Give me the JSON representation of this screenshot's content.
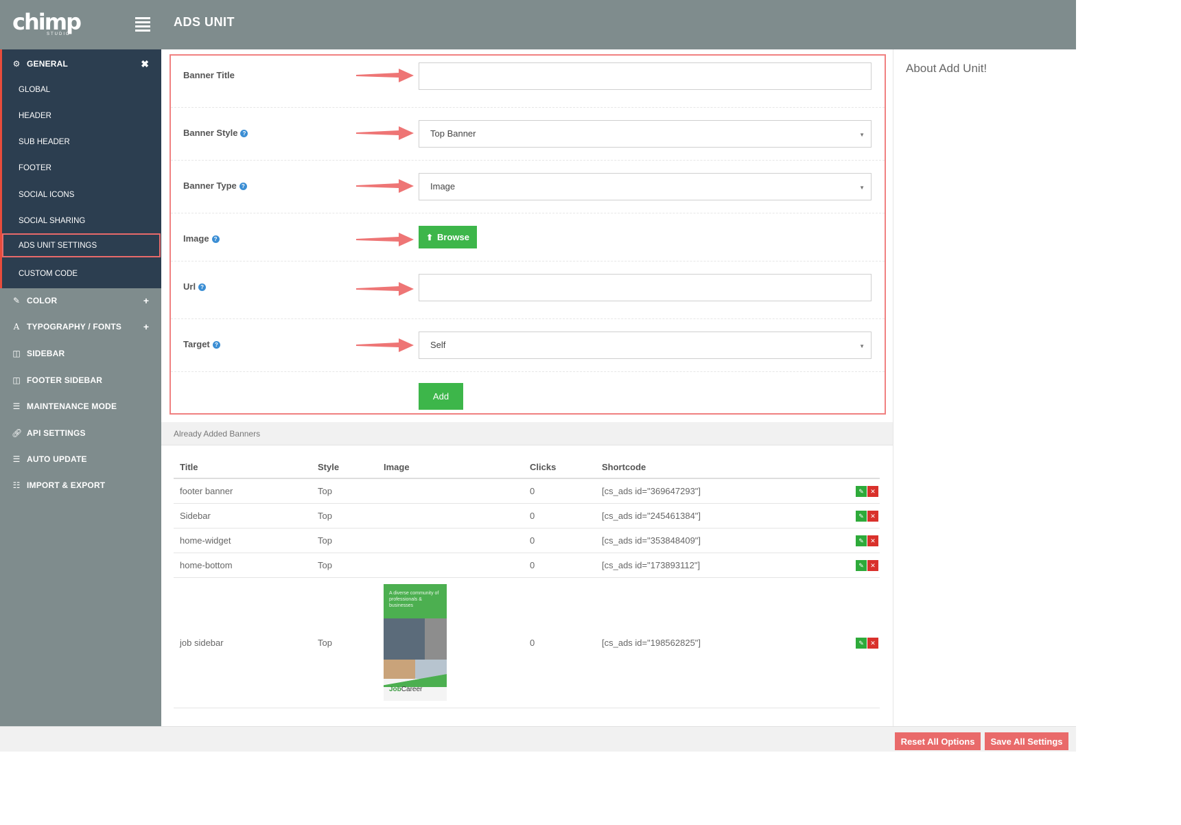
{
  "header": {
    "logo_text": "chimp",
    "logo_sub": "STUDIO",
    "title": "ADS UNIT"
  },
  "sidebar": {
    "general": {
      "label": "GENERAL",
      "toggle": "✖",
      "icon": "gear-icon"
    },
    "general_items": [
      {
        "label": "GLOBAL"
      },
      {
        "label": "HEADER"
      },
      {
        "label": "SUB HEADER"
      },
      {
        "label": "FOOTER"
      },
      {
        "label": "SOCIAL ICONS"
      },
      {
        "label": "SOCIAL SHARING"
      },
      {
        "label": "ADS UNIT SETTINGS",
        "active": true
      },
      {
        "label": "CUSTOM CODE"
      }
    ],
    "items": [
      {
        "label": "COLOR",
        "icon": "magic-wand-icon",
        "toggle": "+"
      },
      {
        "label": "TYPOGRAPHY / FONTS",
        "icon": "font-icon",
        "toggle": "+"
      },
      {
        "label": "SIDEBAR",
        "icon": "columns-icon"
      },
      {
        "label": "FOOTER SIDEBAR",
        "icon": "columns-icon"
      },
      {
        "label": "MAINTENANCE MODE",
        "icon": "list-icon"
      },
      {
        "label": "API SETTINGS",
        "icon": "link-icon"
      },
      {
        "label": "AUTO UPDATE",
        "icon": "list-icon"
      },
      {
        "label": "IMPORT & EXPORT",
        "icon": "database-icon"
      }
    ]
  },
  "form": {
    "banner_title": {
      "label": "Banner Title",
      "value": ""
    },
    "banner_style": {
      "label": "Banner Style",
      "value": "Top Banner"
    },
    "banner_type": {
      "label": "Banner Type",
      "value": "Image"
    },
    "image": {
      "label": "Image",
      "browse_label": "Browse"
    },
    "url": {
      "label": "Url",
      "value": ""
    },
    "target": {
      "label": "Target",
      "value": "Self"
    },
    "add_label": "Add"
  },
  "banners": {
    "section_title": "Already Added Banners",
    "columns": [
      "Title",
      "Style",
      "Image",
      "Clicks",
      "Shortcode"
    ],
    "rows": [
      {
        "title": "footer banner",
        "style": "Top",
        "clicks": "0",
        "shortcode": "[cs_ads id=\"369647293\"]"
      },
      {
        "title": "Sidebar",
        "style": "Top",
        "clicks": "0",
        "shortcode": "[cs_ads id=\"245461384\"]"
      },
      {
        "title": "home-widget",
        "style": "Top",
        "clicks": "0",
        "shortcode": "[cs_ads id=\"353848409\"]"
      },
      {
        "title": "home-bottom",
        "style": "Top",
        "clicks": "0",
        "shortcode": "[cs_ads id=\"173893112\"]"
      },
      {
        "title": "job sidebar",
        "style": "Top",
        "clicks": "0",
        "shortcode": "[cs_ads id=\"198562825\"]",
        "image": {
          "tagline": "A diverse community of professionals & businesses",
          "brand_bold": "Job",
          "brand_rest": "Career"
        }
      }
    ]
  },
  "aside": {
    "title": "About Add Unit!"
  },
  "footer": {
    "reset_label": "Reset All Options",
    "save_label": "Save All Settings"
  },
  "colors": {
    "accent_red": "#e96a6a",
    "sidebar_bg": "#7f8c8d",
    "active_block_bg": "#2c3e50",
    "green": "#3db64a"
  }
}
